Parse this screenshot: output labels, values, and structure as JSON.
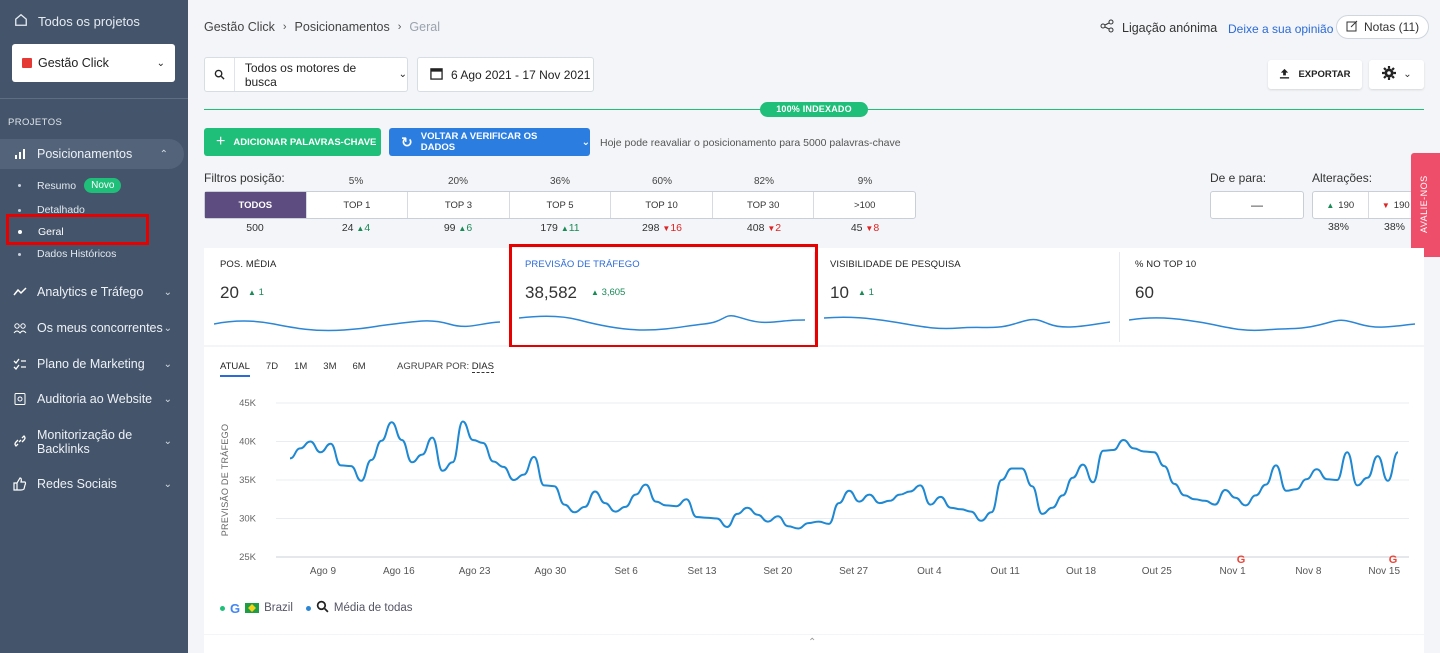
{
  "sidebar": {
    "all_projects": "Todos os projetos",
    "project": "Gestão Click",
    "section": "PROJETOS",
    "items": [
      {
        "label": "Posicionamentos"
      },
      {
        "label": "Analytics e Tráfego"
      },
      {
        "label": "Os meus concorrentes"
      },
      {
        "label": "Plano de Marketing"
      },
      {
        "label": "Auditoria ao Website"
      },
      {
        "label": "Monitorização de Backlinks"
      },
      {
        "label": "Redes Sociais"
      }
    ],
    "subitems": [
      {
        "label": "Resumo",
        "badge": "Novo"
      },
      {
        "label": "Detalhado"
      },
      {
        "label": "Geral"
      },
      {
        "label": "Dados Históricos"
      }
    ]
  },
  "header": {
    "breadcrumb": [
      "Gestão Click",
      "Posicionamentos",
      "Geral"
    ],
    "anon_link": "Ligação anónima",
    "opinion": "Deixe a sua opinião",
    "notes": "Notas (11)"
  },
  "filters": {
    "engines": "Todos os motores de busca",
    "dates": "6 Ago 2021 - 17 Nov 2021",
    "export": "EXPORTAR"
  },
  "indexed": "100% INDEXADO",
  "actions": {
    "add_keywords": "ADICIONAR PALAVRAS-CHAVE",
    "recheck": "VOLTAR A VERIFICAR OS DADOS",
    "recheck_note": "Hoje pode reavaliar o posicionamento para 5000 palavras-chave"
  },
  "position_filters": {
    "label": "Filtros posição:",
    "buttons": [
      {
        "label": "TODOS",
        "pct": "",
        "count": "500",
        "delta": "",
        "dir": ""
      },
      {
        "label": "TOP 1",
        "pct": "5%",
        "count": "24",
        "delta": "4",
        "dir": "up"
      },
      {
        "label": "TOP 3",
        "pct": "20%",
        "count": "99",
        "delta": "6",
        "dir": "up"
      },
      {
        "label": "TOP 5",
        "pct": "36%",
        "count": "179",
        "delta": "11",
        "dir": "up"
      },
      {
        "label": "TOP 10",
        "pct": "60%",
        "count": "298",
        "delta": "16",
        "dir": "down"
      },
      {
        "label": "TOP 30",
        "pct": "82%",
        "count": "408",
        "delta": "2",
        "dir": "down"
      },
      {
        "label": ">100",
        "pct": "9%",
        "count": "45",
        "delta": "8",
        "dir": "down"
      }
    ],
    "range_label": "De e para:",
    "range_value": "—",
    "changes_label": "Alterações:",
    "changes": [
      {
        "value": "190",
        "dir": "up",
        "pct": "38%"
      },
      {
        "value": "190",
        "dir": "down",
        "pct": "38%"
      }
    ]
  },
  "avalie": "AVALIE-NOS",
  "metrics": [
    {
      "title": "POS. MÉDIA",
      "value": "20",
      "delta": "1"
    },
    {
      "title": "PREVISÃO DE TRÁFEGO",
      "value": "38,582",
      "delta": "3,605"
    },
    {
      "title": "VISIBILIDADE DE PESQUISA",
      "value": "10",
      "delta": "1"
    },
    {
      "title": "% NO TOP 10",
      "value": "60",
      "delta": ""
    }
  ],
  "chart_tabs": [
    "ATUAL",
    "7D",
    "1M",
    "3M",
    "6M"
  ],
  "group_by": {
    "label": "AGRUPAR POR:",
    "value": "DIAS"
  },
  "legend": {
    "country": "Brazil",
    "avg": "Média de todas"
  },
  "chart_data": {
    "type": "line",
    "ylabel": "PREVISÃO DE TRÁFEGO",
    "ylim": [
      25000,
      45000
    ],
    "yticks": [
      "45K",
      "40K",
      "35K",
      "30K",
      "25K"
    ],
    "xticks": [
      "Ago 9",
      "Ago 16",
      "Ago 23",
      "Ago 30",
      "Set 6",
      "Set 13",
      "Set 20",
      "Set 27",
      "Out 4",
      "Out 11",
      "Out 18",
      "Out 25",
      "Nov 1",
      "Nov 8",
      "Nov 15"
    ],
    "series": [
      {
        "values": [
          37800,
          39100,
          40000,
          38600,
          39700,
          36900,
          36800,
          34900,
          37600,
          40100,
          42500,
          40200,
          37300,
          38300,
          40500,
          36200,
          37300,
          42600,
          40200,
          39800,
          37400,
          36700,
          35000,
          35700,
          38000,
          34300,
          34200,
          31800,
          30800,
          31500,
          33500,
          32000,
          30900,
          31500,
          33100,
          34400,
          32200,
          31700,
          31600,
          32500,
          30200,
          30100,
          30000,
          28900,
          30600,
          31400,
          30500,
          29600,
          30300,
          29000,
          28700,
          29400,
          29600,
          29300,
          32000,
          33600,
          32200,
          33100,
          32000,
          32300,
          33100,
          33500,
          34300,
          31800,
          32800,
          31400,
          31200,
          30900,
          29700,
          30800,
          35000,
          36500,
          36500,
          34200,
          30600,
          31400,
          33000,
          35300,
          37000,
          34700,
          38800,
          38900,
          40200,
          39100,
          38700,
          38600,
          36800,
          34500,
          33000,
          32500,
          32300,
          31800,
          33700,
          32700,
          31700,
          33000,
          34400,
          36900,
          33600,
          33800,
          35100,
          36400,
          35100,
          35000,
          38600,
          34300,
          35300,
          38100,
          34900,
          38600
        ]
      }
    ]
  }
}
